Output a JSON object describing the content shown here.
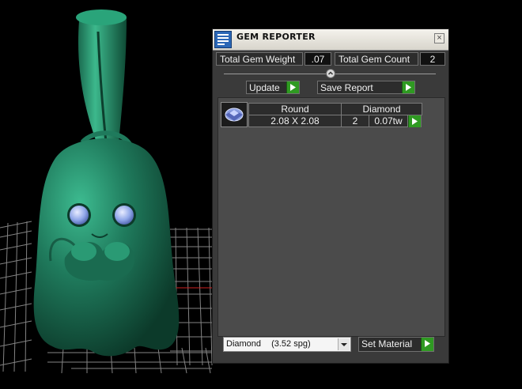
{
  "panel": {
    "title": "GEM REPORTER",
    "close_glyph": "×",
    "total_weight_label": "Total Gem Weight",
    "total_weight_value": ".07",
    "total_count_label": "Total Gem Count",
    "total_count_value": "2",
    "update_label": "Update",
    "save_report_label": "Save Report"
  },
  "gems": [
    {
      "icon": "round-diamond-icon",
      "shape": "Round",
      "material": "Diamond",
      "size": "2.08 X 2.08",
      "quantity": "2",
      "weight": "0.07tw"
    }
  ],
  "footer": {
    "material_name": "Diamond",
    "material_spg": "(3.52 spg)",
    "set_material_label": "Set Material"
  },
  "colors": {
    "model_green": "#1f7a5c",
    "button_arrow_green": "#2f9a22",
    "panel_background": "#3a3a3a"
  }
}
